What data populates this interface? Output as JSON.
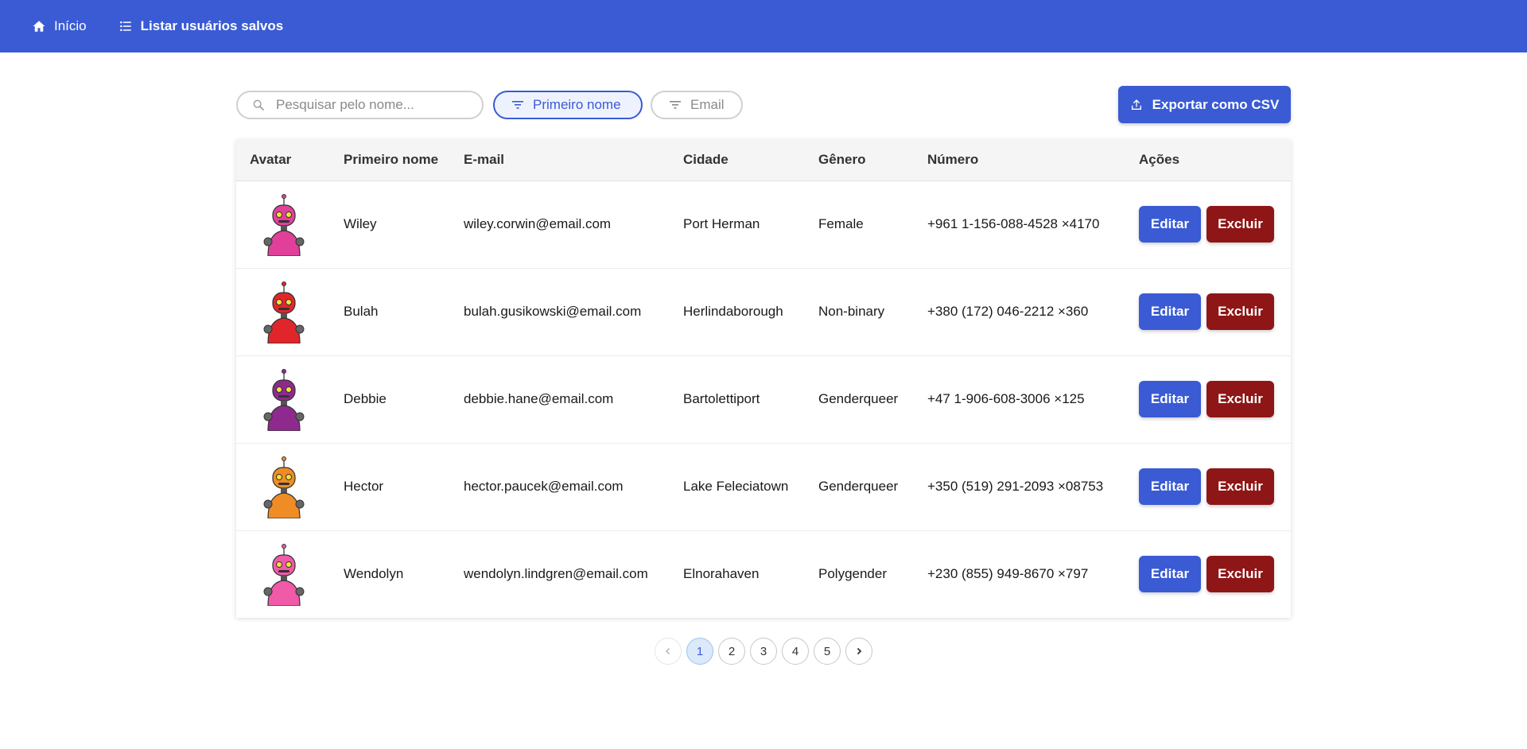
{
  "nav": {
    "home_label": "Início",
    "list_label": "Listar usuários salvos"
  },
  "toolbar": {
    "search_placeholder": "Pesquisar pelo nome...",
    "filter_first_name": "Primeiro nome",
    "filter_email": "Email",
    "export_label": "Exportar como CSV"
  },
  "table": {
    "headers": [
      "Avatar",
      "Primeiro nome",
      "E-mail",
      "Cidade",
      "Gênero",
      "Número",
      "Ações"
    ],
    "rows": [
      {
        "first_name": "Wiley",
        "email": "wiley.corwin@email.com",
        "city": "Port Herman",
        "gender": "Female",
        "phone": "+961 1-156-088-4528 ×4170",
        "avatar_color": "#e0409a"
      },
      {
        "first_name": "Bulah",
        "email": "bulah.gusikowski@email.com",
        "city": "Herlindaborough",
        "gender": "Non-binary",
        "phone": "+380 (172) 046-2212 ×360",
        "avatar_color": "#e0262a"
      },
      {
        "first_name": "Debbie",
        "email": "debbie.hane@email.com",
        "city": "Bartolettiport",
        "gender": "Genderqueer",
        "phone": "+47 1-906-608-3006 ×125",
        "avatar_color": "#8e2a8e"
      },
      {
        "first_name": "Hector",
        "email": "hector.paucek@email.com",
        "city": "Lake Feleciatown",
        "gender": "Genderqueer",
        "phone": "+350 (519) 291-2093 ×08753",
        "avatar_color": "#f08c24"
      },
      {
        "first_name": "Wendolyn",
        "email": "wendolyn.lindgren@email.com",
        "city": "Elnorahaven",
        "gender": "Polygender",
        "phone": "+230 (855) 949-8670 ×797",
        "avatar_color": "#f05aa8"
      }
    ],
    "edit_label": "Editar",
    "delete_label": "Excluir"
  },
  "pagination": {
    "pages": [
      "1",
      "2",
      "3",
      "4",
      "5"
    ],
    "current": "1"
  },
  "colors": {
    "primary": "#3a5bd4",
    "danger": "#8f1616"
  }
}
